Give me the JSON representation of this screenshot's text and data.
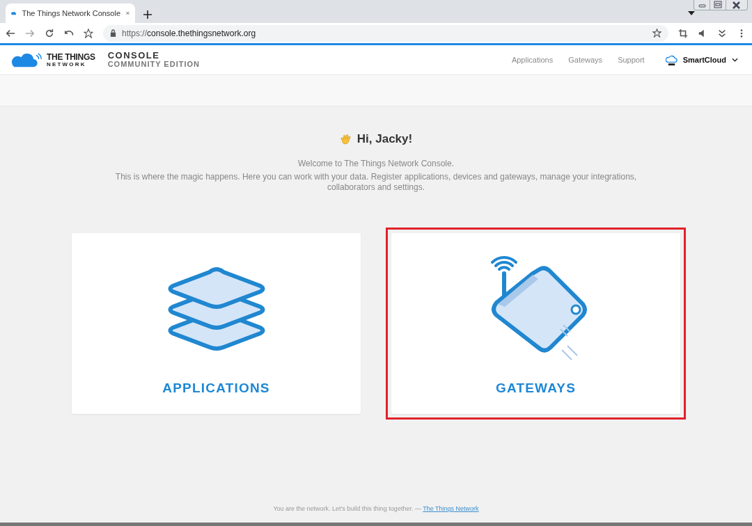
{
  "browser": {
    "tab": {
      "title": "The Things Network Console",
      "selected": true
    },
    "url": {
      "scheme": "https://",
      "host": "console.thethingsnetwork.org"
    }
  },
  "header": {
    "logo": {
      "line1": "THE THINGS",
      "line2": "NETWORK"
    },
    "product": {
      "title": "CONSOLE",
      "subtitle": "COMMUNITY EDITION"
    },
    "nav": [
      {
        "label": "Applications"
      },
      {
        "label": "Gateways"
      },
      {
        "label": "Support"
      }
    ],
    "user": {
      "name": "SmartCloud"
    }
  },
  "welcome": {
    "greeting": "Hi, Jacky!",
    "line1": "Welcome to The Things Network Console.",
    "line2": "This is where the magic happens. Here you can work with your data. Register applications, devices and gateways, manage your integrations, collaborators and settings."
  },
  "cards": [
    {
      "kind": "applications",
      "label": "APPLICATIONS",
      "highlighted": false
    },
    {
      "kind": "gateways",
      "label": "GATEWAYS",
      "highlighted": true
    }
  ],
  "footer": {
    "text": "You are the network. Let's build this thing together. —",
    "link": "The Things Network"
  }
}
